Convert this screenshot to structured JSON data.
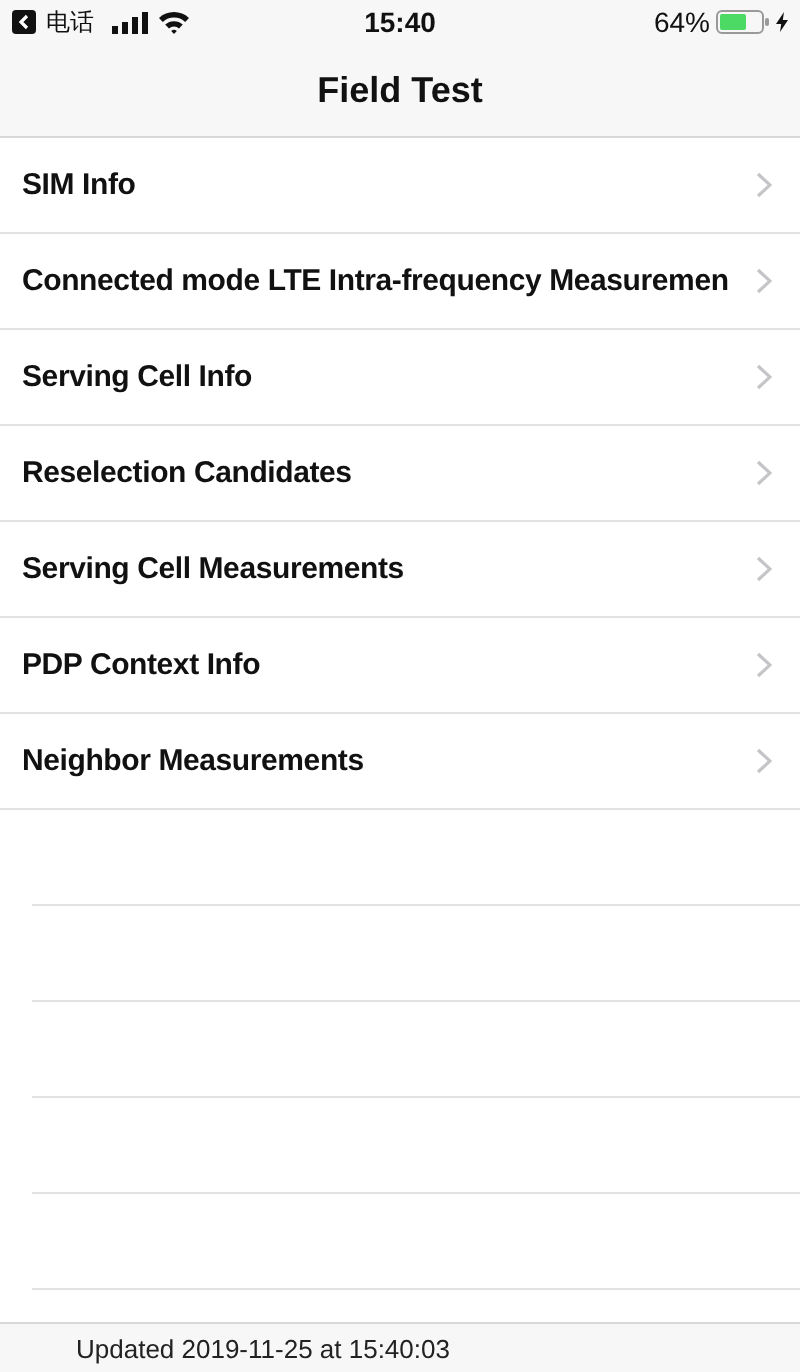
{
  "status_bar": {
    "back_app": "电话",
    "time": "15:40",
    "battery": "64%"
  },
  "nav": {
    "title": "Field Test"
  },
  "menu": [
    {
      "label": "SIM Info"
    },
    {
      "label": "Connected mode LTE Intra-frequency Measuremen"
    },
    {
      "label": "Serving Cell Info"
    },
    {
      "label": "Reselection Candidates"
    },
    {
      "label": "Serving Cell Measurements"
    },
    {
      "label": "PDP Context Info"
    },
    {
      "label": "Neighbor Measurements"
    }
  ],
  "footer": {
    "text": "Updated 2019-11-25 at 15:40:03"
  }
}
